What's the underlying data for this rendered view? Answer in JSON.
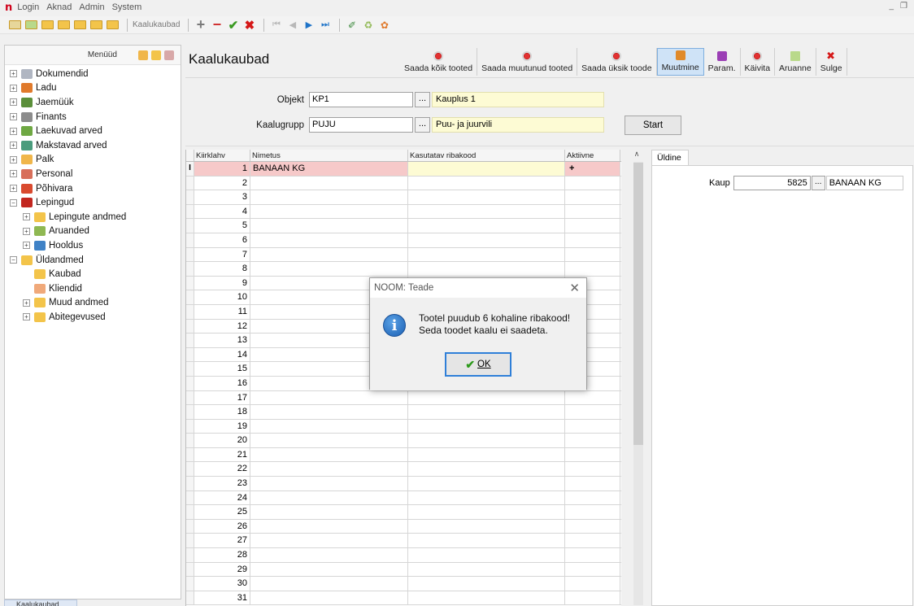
{
  "menubar": {
    "logo": "n",
    "items": [
      "Login",
      "Aknad",
      "Admin",
      "System"
    ]
  },
  "toolbar": {
    "form_label": "Kaalukaubad"
  },
  "sidebar": {
    "title": "Menüüd",
    "items": [
      {
        "label": "Dokumendid",
        "level": 0,
        "expander": "+",
        "color": "#b0b6c2"
      },
      {
        "label": "Ladu",
        "level": 0,
        "expander": "+",
        "color": "#e07a2c"
      },
      {
        "label": "Jaemüük",
        "level": 0,
        "expander": "+",
        "color": "#5b8f3a"
      },
      {
        "label": "Finants",
        "level": 0,
        "expander": "+",
        "color": "#8c8c8c"
      },
      {
        "label": "Laekuvad arved",
        "level": 0,
        "expander": "+",
        "color": "#6fa843"
      },
      {
        "label": "Makstavad arved",
        "level": 0,
        "expander": "+",
        "color": "#4a9c7d"
      },
      {
        "label": "Palk",
        "level": 0,
        "expander": "+",
        "color": "#f0b64a"
      },
      {
        "label": "Personal",
        "level": 0,
        "expander": "+",
        "color": "#d86f5a"
      },
      {
        "label": "Põhivara",
        "level": 0,
        "expander": "+",
        "color": "#d94a2f"
      },
      {
        "label": "Lepingud",
        "level": 0,
        "expander": "−",
        "color": "#c2261f"
      },
      {
        "label": "Lepingute andmed",
        "level": 1,
        "expander": "+",
        "color": "#f3c44a"
      },
      {
        "label": "Aruanded",
        "level": 1,
        "expander": "+",
        "color": "#8fb852"
      },
      {
        "label": "Hooldus",
        "level": 1,
        "expander": "+",
        "color": "#3f82c6"
      },
      {
        "label": "Üldandmed",
        "level": 0,
        "expander": "−",
        "color": "#f3c44a"
      },
      {
        "label": "Kaubad",
        "level": 1,
        "expander": "",
        "color": "#f3c44a"
      },
      {
        "label": "Kliendid",
        "level": 1,
        "expander": "",
        "color": "#f0a97a"
      },
      {
        "label": "Muud andmed",
        "level": 1,
        "expander": "+",
        "color": "#f3c44a"
      },
      {
        "label": "Abitegevused",
        "level": 1,
        "expander": "+",
        "color": "#f3c44a"
      }
    ]
  },
  "bottom_tab": {
    "label": "Kaalukaubad"
  },
  "main": {
    "title": "Kaalukaubad",
    "ribbon": [
      {
        "label": "Saada kõik tooted",
        "icon": "record-icon",
        "pressed": false
      },
      {
        "label": "Saada muutunud tooted",
        "icon": "record-icon",
        "pressed": false
      },
      {
        "label": "Saada üksik toode",
        "icon": "record-icon",
        "pressed": false
      },
      {
        "label": "Muutmine",
        "icon": "edit-icon",
        "pressed": true
      },
      {
        "label": "Param.",
        "icon": "param-icon",
        "pressed": false
      },
      {
        "label": "Käivita",
        "icon": "record-icon",
        "pressed": false
      },
      {
        "label": "Aruanne",
        "icon": "report-icon",
        "pressed": false
      },
      {
        "label": "Sulge",
        "icon": "close-icon",
        "pressed": false
      }
    ],
    "form": {
      "objekt_label": "Objekt",
      "objekt_value": "KP1",
      "objekt_desc": "Kauplus 1",
      "grupp_label": "Kaalugrupp",
      "grupp_value": "PUJU",
      "grupp_desc": "Puu- ja juurvili",
      "dots": "...",
      "start_label": "Start"
    },
    "grid": {
      "columns": [
        "Kiirklahv",
        "Nimetus",
        "Kasutatav ribakood",
        "Aktiivne"
      ],
      "cursor": "I",
      "rows": [
        {
          "num": "1",
          "name": "BANAAN KG",
          "code": "",
          "active": "+"
        },
        {
          "num": "2"
        },
        {
          "num": "3"
        },
        {
          "num": "4"
        },
        {
          "num": "5"
        },
        {
          "num": "6"
        },
        {
          "num": "7"
        },
        {
          "num": "8"
        },
        {
          "num": "9"
        },
        {
          "num": "10"
        },
        {
          "num": "11"
        },
        {
          "num": "12"
        },
        {
          "num": "13"
        },
        {
          "num": "14"
        },
        {
          "num": "15"
        },
        {
          "num": "16"
        },
        {
          "num": "17"
        },
        {
          "num": "18"
        },
        {
          "num": "19"
        },
        {
          "num": "20"
        },
        {
          "num": "21"
        },
        {
          "num": "22"
        },
        {
          "num": "23"
        },
        {
          "num": "24"
        },
        {
          "num": "25"
        },
        {
          "num": "26"
        },
        {
          "num": "27"
        },
        {
          "num": "28"
        },
        {
          "num": "29"
        },
        {
          "num": "30"
        },
        {
          "num": "31"
        }
      ]
    },
    "right_panel": {
      "tab": "Üldine",
      "kaup_label": "Kaup",
      "kaup_value": "5825",
      "kaup_dots": "...",
      "kaup_desc": "BANAAN KG"
    }
  },
  "dialog": {
    "title": "NOOM: Teade",
    "close": "✕",
    "line1": "Tootel puudub 6 kohaline ribakood!",
    "line2": "Seda toodet kaalu ei saadeta.",
    "ok_label": "OK",
    "icon": "i"
  },
  "colors": {
    "selected_row": "#f6c9c9",
    "desc_fill": "#fdfbd4",
    "accent": "#2f7fd8"
  }
}
